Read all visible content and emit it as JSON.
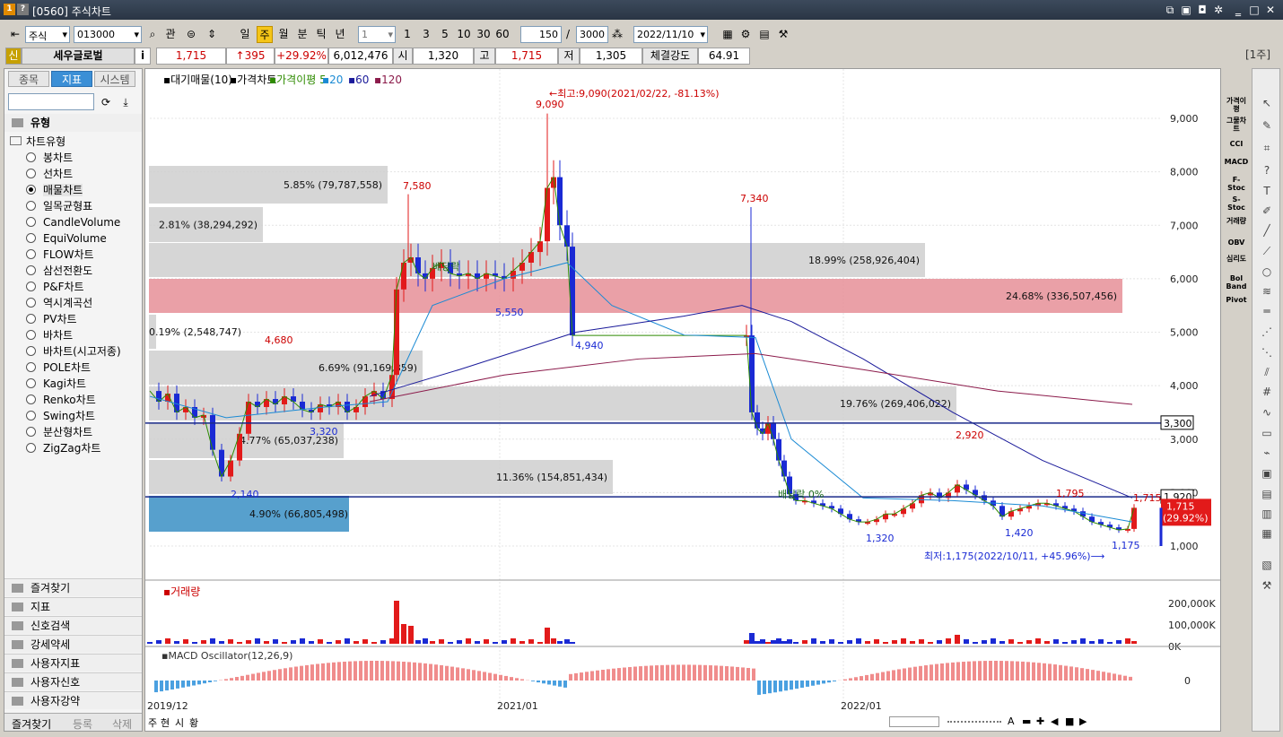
{
  "window": {
    "title": "[0560] 주식차트",
    "icons": [
      "1",
      "?"
    ]
  },
  "toolbar": {
    "market": "주식",
    "code": "013000",
    "btn_gwan": "관",
    "periods": [
      "일",
      "주",
      "월",
      "분",
      "틱",
      "년"
    ],
    "period_selected": "주",
    "interval_select": "1",
    "intervals": [
      "1",
      "3",
      "5",
      "10",
      "30",
      "60"
    ],
    "count": "150",
    "slash": "/",
    "total": "3000",
    "date": "2022/11/10"
  },
  "quote": {
    "badge": "신",
    "name": "세우글로벌",
    "info_icon": "i",
    "price": "1,715",
    "change": "↑395",
    "change_pct": "+29.92%",
    "volume": "6,012,476",
    "open_label": "시",
    "open": "1,320",
    "high_label": "고",
    "high": "1,715",
    "low_label": "저",
    "low": "1,305",
    "strength_label": "체결강도",
    "strength": "64.91",
    "unit": "[1주]"
  },
  "left_panel": {
    "tabs": [
      "종목",
      "지표",
      "시스템"
    ],
    "active_tab": "지표",
    "section_title": "유형",
    "tree_root": "차트유형",
    "chart_types": [
      "봉차트",
      "선차트",
      "매물차트",
      "일목균형표",
      "CandleVolume",
      "EquiVolume",
      "FLOW차트",
      "삼선전환도",
      "P&F차트",
      "역시계곡선",
      "PV차트",
      "바차트",
      "바차트(시고저종)",
      "POLE차트",
      "Kagi차트",
      "Renko차트",
      "Swing차트",
      "분산형차트",
      "ZigZag차트"
    ],
    "selected_type": "매물차트",
    "folders": [
      "즐겨찾기",
      "지표",
      "신호검색",
      "강세약세",
      "사용자지표",
      "사용자신호",
      "사용자강약"
    ],
    "bottom_tabs": [
      "즐겨찾기",
      "등록",
      "삭제"
    ]
  },
  "chart": {
    "legend": [
      "대기매물(10)",
      "가격차트",
      "가격이평 5",
      "20",
      "60",
      "120"
    ],
    "legend_colors": [
      "#000000",
      "#000000",
      "#2e8b00",
      "#1a8ad4",
      "#1a1a9a",
      "#8b1a4a"
    ],
    "y_axis_ticks": [
      "9,000",
      "8,000",
      "7,000",
      "6,000",
      "5,000",
      "4,000",
      "3,000",
      "2,000",
      "1,000"
    ],
    "price_badges": {
      "hline": "3,300",
      "cursor": "1,920",
      "current": "1,715",
      "current_pct": "(29.92%)"
    },
    "max_label": "←최고:9,090(2021/02/22, -81.13%)",
    "min_label": "최저:1,175(2022/10/11, +45.96%)⟶",
    "point_labels": [
      "9,090",
      "7,580",
      "7,340",
      "5,550",
      "4,940",
      "4,680",
      "3,320",
      "2,140",
      "2,920",
      "1,795",
      "1,715",
      "1,420",
      "1,320",
      "1,175"
    ],
    "mid_labels": [
      "배당락",
      "배당락 0%"
    ],
    "volume_profile": [
      "5.85% (79,787,558)",
      "2.81% (38,294,292)",
      "18.99% (258,926,404)",
      "24.68% (336,507,456)",
      "0.19% (2,548,747)",
      "6.69% (91,169,859)",
      "19.76% (269,406,022)",
      "4.77% (65,037,238)",
      "11.36% (154,851,434)",
      "4.90% (66,805,498)"
    ],
    "volume_pane": {
      "title": "거래량",
      "ticks": [
        "200,000K",
        "100,000K",
        "0K"
      ]
    },
    "macd_pane": {
      "title": "MACD Oscillator(12,26,9)",
      "ticks": [
        "0"
      ]
    },
    "x_labels": [
      "2019/12",
      "2021/01",
      "2022/01"
    ]
  },
  "right_toolbar": [
    "가격이평",
    "그물차트",
    "CCI",
    "MACD",
    "F-Stoc",
    "S-Stoc",
    "거래량",
    "OBV",
    "심리도",
    "Bol Band",
    "Pivot"
  ],
  "statusbar": {
    "left_btns": [
      "주",
      "현",
      "시",
      "황"
    ],
    "right_btns": [
      "A",
      "▬",
      "✚",
      "◀",
      "■",
      "▶"
    ]
  },
  "icons": [
    "search-icon",
    "refresh-icon",
    "download-icon",
    "folder-icon",
    "gear-icon",
    "close-icon",
    "minimize-icon",
    "maximize-icon",
    "cursor-icon",
    "pencil-icon",
    "line-icon",
    "circle-icon",
    "text-icon"
  ]
}
